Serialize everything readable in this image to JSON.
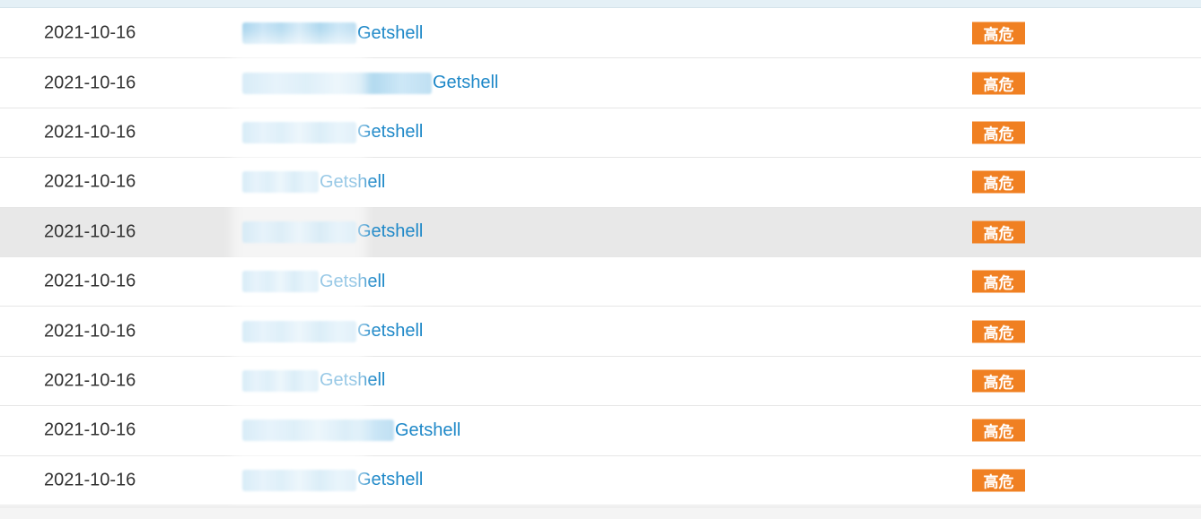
{
  "rows": [
    {
      "date": "2021-10-16",
      "title_suffix": "Getshell",
      "severity": "高危"
    },
    {
      "date": "2021-10-16",
      "title_suffix": "Getshell",
      "severity": "高危"
    },
    {
      "date": "2021-10-16",
      "title_suffix": "Getshell",
      "severity": "高危"
    },
    {
      "date": "2021-10-16",
      "title_suffix": "Getshell",
      "severity": "高危"
    },
    {
      "date": "2021-10-16",
      "title_suffix": "Getshell",
      "severity": "高危"
    },
    {
      "date": "2021-10-16",
      "title_suffix": "Getshell",
      "severity": "高危"
    },
    {
      "date": "2021-10-16",
      "title_suffix": "Getshell",
      "severity": "高危"
    },
    {
      "date": "2021-10-16",
      "title_suffix": "Getshell",
      "severity": "高危"
    },
    {
      "date": "2021-10-16",
      "title_suffix": "Getshell",
      "severity": "高危"
    },
    {
      "date": "2021-10-16",
      "title_suffix": "Getshell",
      "severity": "高危"
    }
  ],
  "colors": {
    "link": "#1e88c8",
    "severity_badge": "#f08022",
    "hover_row": "#e8e8e8",
    "top_band": "#e4f0f6"
  }
}
